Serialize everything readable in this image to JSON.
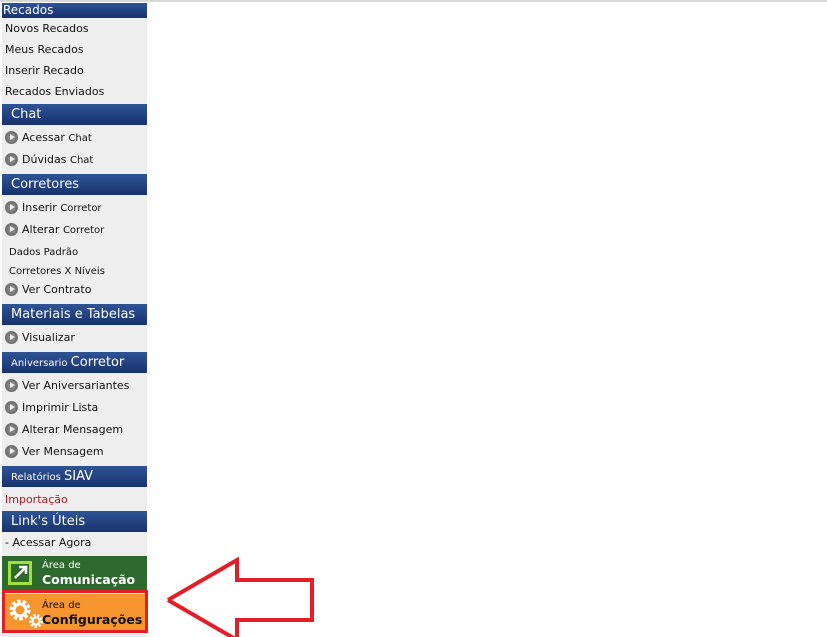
{
  "sections": [
    {
      "title": "Recados",
      "items": [
        "Novos Recados",
        "Meus Recados",
        "Inserir Recado",
        "Recados Enviados"
      ]
    },
    {
      "title": "Chat",
      "items": [
        {
          "a": "Acessar ",
          "b": "Chat"
        },
        {
          "a": "Dúvidas ",
          "b": "Chat"
        }
      ]
    },
    {
      "title": "Corretores",
      "items": [
        {
          "a": "Inserir ",
          "b": "Corretor"
        },
        {
          "a": "Alterar ",
          "b": "Corretor"
        },
        "Dados Padrão",
        "Corretores X Níveis",
        "Ver Contrato"
      ]
    },
    {
      "title": "Materiais e Tabelas",
      "items": [
        "Visualizar"
      ]
    },
    {
      "title_small": "Aniversario ",
      "title": "Corretor",
      "items": [
        "Ver Aniversariantes",
        "Imprimir Lista",
        "Alterar Mensagem",
        "Ver Mensagem"
      ]
    },
    {
      "title_small": "Relatórios ",
      "title": "SIAV",
      "items": [
        "Importação"
      ]
    },
    {
      "title": "Link's Úteis",
      "items": [
        "- Acessar Agora"
      ]
    }
  ],
  "comunicacao": {
    "line1": "Área de",
    "line2": "Comunicação",
    "color": "#2e6a2e"
  },
  "configuracoes": {
    "line1": "Área de",
    "line2": "Configurações",
    "color": "#f7962e"
  },
  "highlight_color": "#e41e26"
}
